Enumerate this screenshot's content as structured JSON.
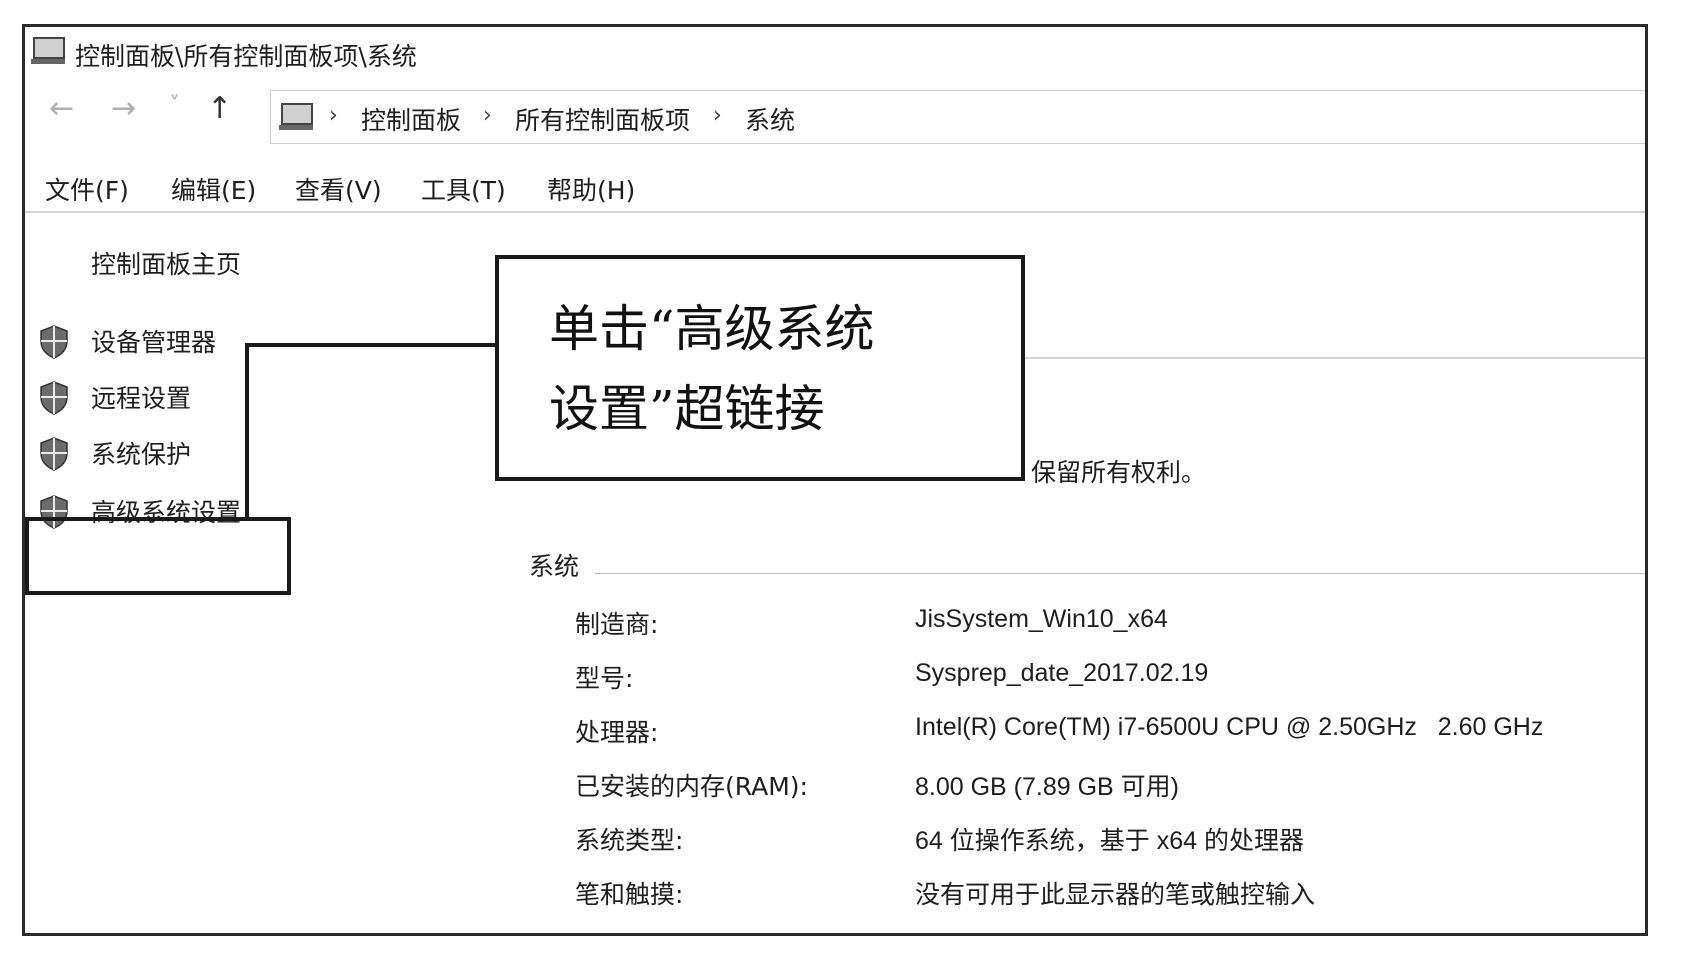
{
  "window": {
    "title": "控制面板\\所有控制面板项\\系统"
  },
  "nav": {
    "back": "←",
    "forward": "→",
    "recent": "˅",
    "up": "↑",
    "breadcrumb": [
      "控制面板",
      "所有控制面板项",
      "系统"
    ],
    "separator": "›"
  },
  "menu": [
    "文件(F)",
    "编辑(E)",
    "查看(V)",
    "工具(T)",
    "帮助(H)"
  ],
  "sidebar": {
    "home": "控制面板主页",
    "items": [
      {
        "label": "设备管理器",
        "icon": "shield-icon"
      },
      {
        "label": "远程设置",
        "icon": "shield-icon"
      },
      {
        "label": "系统保护",
        "icon": "shield-icon"
      },
      {
        "label": "高级系统设置",
        "icon": "shield-icon"
      }
    ]
  },
  "callout": {
    "line1": "单击“高级系统",
    "line2": "设置”超链接"
  },
  "copyright_fragment": "保留所有权利。",
  "system": {
    "heading": "系统",
    "rows": [
      {
        "label": "制造商:",
        "value": "JisSystem_Win10_x64"
      },
      {
        "label": "型号:",
        "value": "Sysprep_date_2017.02.19"
      },
      {
        "label": "处理器:",
        "value": "Intel(R) Core(TM) i7-6500U CPU @ 2.50GHz   2.60 GHz"
      },
      {
        "label": "已安装的内存(RAM):",
        "value": "8.00 GB (7.89 GB 可用)"
      },
      {
        "label": "系统类型:",
        "value": "64 位操作系统，基于 x64 的处理器"
      },
      {
        "label": "笔和触摸:",
        "value": "没有可用于此显示器的笔或触控输入"
      }
    ]
  }
}
